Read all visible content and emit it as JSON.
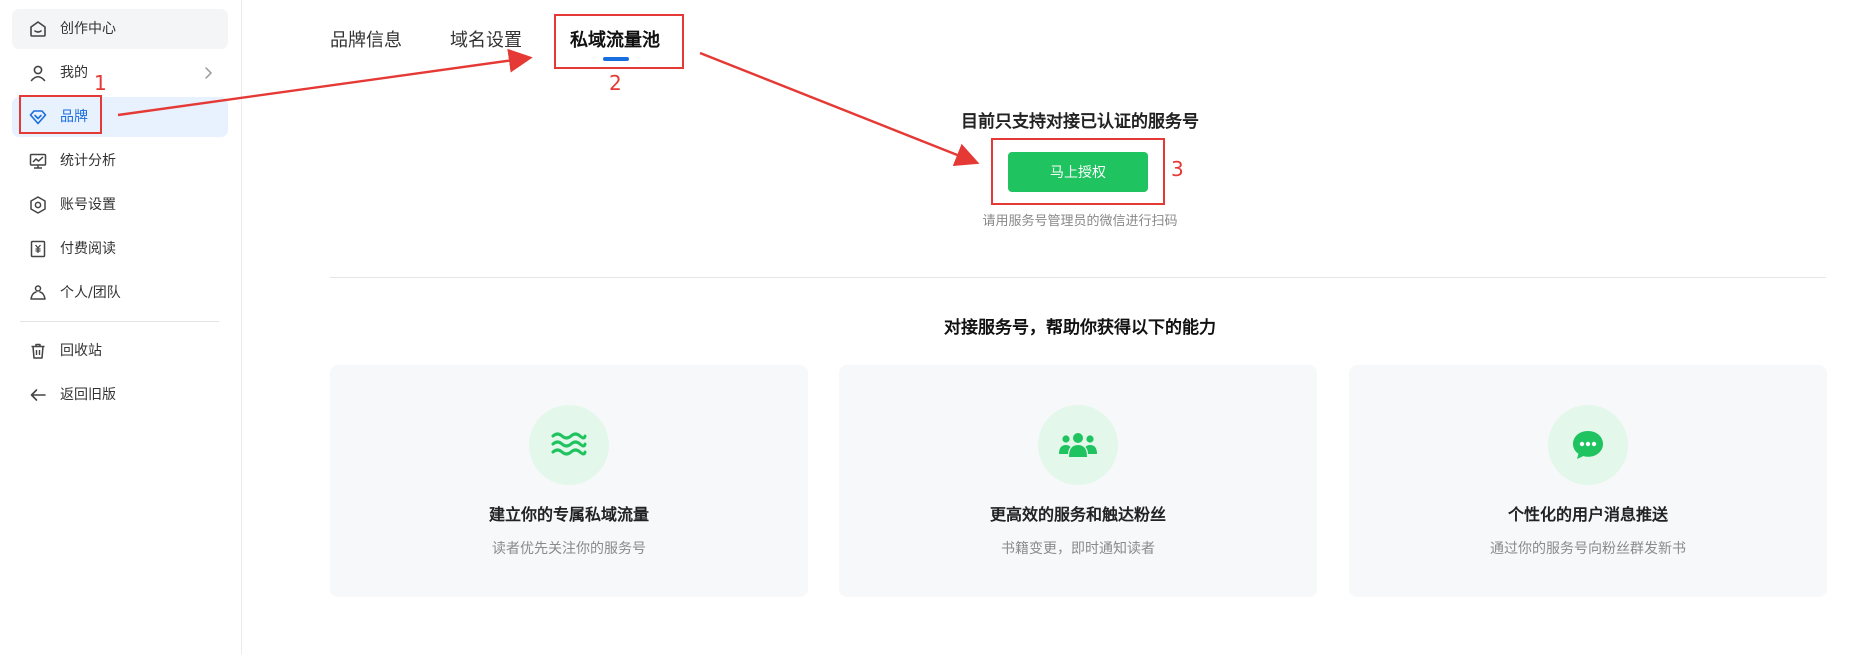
{
  "sidebar": {
    "items": [
      {
        "label": "创作中心",
        "icon": "home-icon"
      },
      {
        "label": "我的",
        "icon": "user-icon"
      },
      {
        "label": "品牌",
        "icon": "diamond-icon"
      },
      {
        "label": "统计分析",
        "icon": "chart-monitor-icon"
      },
      {
        "label": "账号设置",
        "icon": "hexagon-gear-icon"
      },
      {
        "label": "付费阅读",
        "icon": "yen-book-icon"
      },
      {
        "label": "个人/团队",
        "icon": "team-icon"
      },
      {
        "label": "回收站",
        "icon": "trash-icon"
      },
      {
        "label": "返回旧版",
        "icon": "arrow-left-icon"
      }
    ],
    "active_item": "品牌"
  },
  "tabs": [
    {
      "label": "品牌信息"
    },
    {
      "label": "域名设置"
    },
    {
      "label": "私域流量池"
    }
  ],
  "active_tab": "私域流量池",
  "annotations": [
    "1",
    "2",
    "3"
  ],
  "authorize": {
    "title": "目前只支持对接已认证的服务号",
    "button": "马上授权",
    "hint": "请用服务号管理员的微信进行扫码"
  },
  "abilities": {
    "title": "对接服务号，帮助你获得以下的能力",
    "cards": [
      {
        "icon": "waves-icon",
        "title": "建立你的专属私域流量",
        "desc": "读者优先关注你的服务号"
      },
      {
        "icon": "group-icon",
        "title": "更高效的服务和触达粉丝",
        "desc": "书籍变更，即时通知读者"
      },
      {
        "icon": "chat-bubble-icon",
        "title": "个性化的用户消息推送",
        "desc": "通过你的服务号向粉丝群发新书"
      }
    ]
  },
  "colors": {
    "accent_blue": "#1a6dde",
    "button_green": "#1fc35f",
    "annotation_red": "#e53935",
    "icon_green": "#1fc35f",
    "icon_bg": "#e3f7ea"
  }
}
